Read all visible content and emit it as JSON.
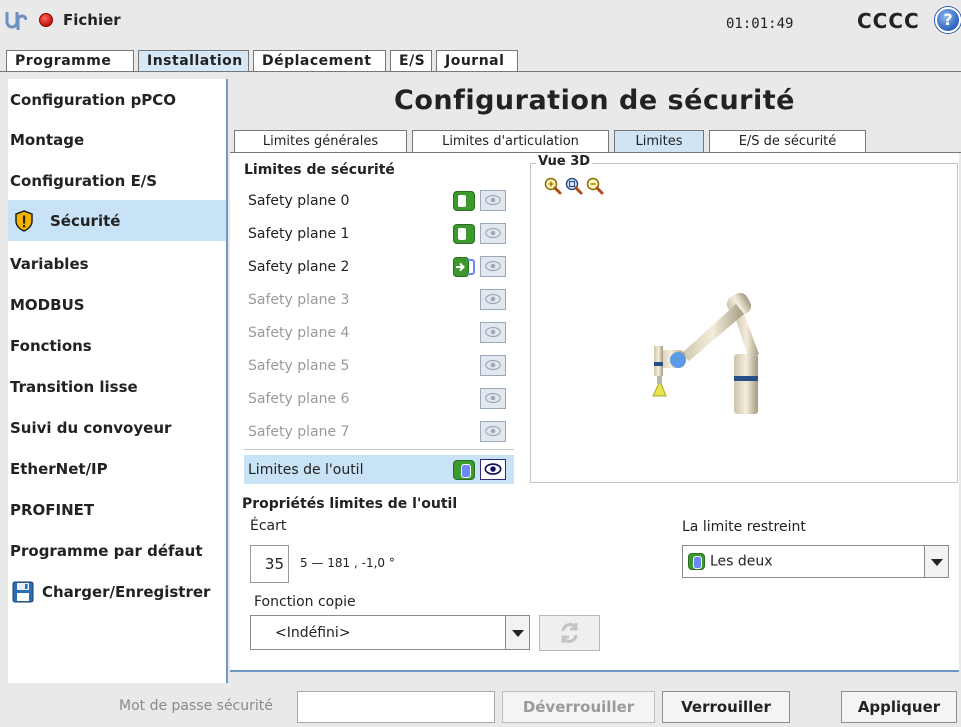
{
  "header": {
    "file_label": "Fichier",
    "clock": "01:01:49",
    "robot_name": "CCCC",
    "help_symbol": "?"
  },
  "main_tabs": [
    {
      "label": "Programme",
      "active": false
    },
    {
      "label": "Installation",
      "active": true
    },
    {
      "label": "Déplacement",
      "active": false
    },
    {
      "label": "E/S",
      "active": false
    },
    {
      "label": "Journal",
      "active": false
    }
  ],
  "sidebar": {
    "items": [
      {
        "label": "Configuration pPCO"
      },
      {
        "label": "Montage"
      },
      {
        "label": "Configuration E/S"
      },
      {
        "label": "Sécurité",
        "icon": "shield-warning-icon",
        "active": true
      },
      {
        "label": "Variables"
      },
      {
        "label": "MODBUS"
      },
      {
        "label": "Fonctions"
      },
      {
        "label": "Transition lisse"
      },
      {
        "label": "Suivi du convoyeur"
      },
      {
        "label": "EtherNet/IP"
      },
      {
        "label": "PROFINET"
      },
      {
        "label": "Programme par défaut"
      },
      {
        "label": "Charger/Enregistrer",
        "icon": "floppy-disk-icon"
      }
    ]
  },
  "page_title": "Configuration de sécurité",
  "sub_tabs": [
    {
      "label": "Limites générales",
      "active": false
    },
    {
      "label": "Limites d'articulation",
      "active": false
    },
    {
      "label": "Limites",
      "active": true
    },
    {
      "label": "E/S de sécurité",
      "active": false
    }
  ],
  "limits": {
    "section_title": "Limites de sécurité",
    "planes": [
      {
        "label": "Safety plane 0",
        "state": "on"
      },
      {
        "label": "Safety plane 1",
        "state": "on"
      },
      {
        "label": "Safety plane 2",
        "state": "trigger"
      },
      {
        "label": "Safety plane 3",
        "state": "disabled"
      },
      {
        "label": "Safety plane 4",
        "state": "disabled"
      },
      {
        "label": "Safety plane 5",
        "state": "disabled"
      },
      {
        "label": "Safety plane 6",
        "state": "disabled"
      },
      {
        "label": "Safety plane 7",
        "state": "disabled"
      }
    ],
    "tool_limit": {
      "label": "Limites de l'outil",
      "selected": true
    }
  },
  "view3d": {
    "title": "Vue 3D",
    "zoom_icons": [
      "zoom-in-icon",
      "zoom-reset-icon",
      "zoom-out-icon"
    ]
  },
  "tool_props": {
    "title": "Propriétés limites de l'outil",
    "ecart_label": "Écart",
    "ecart_value": "35",
    "ecart_range": "5 — 181 , -1,0 °",
    "restrict_label": "La limite restreint",
    "restrict_value": "Les deux",
    "copy_label": "Fonction copie",
    "copy_value": "<Indéfini>"
  },
  "footer": {
    "password_label": "Mot de passe sécurité",
    "password_value": "",
    "unlock_label": "Déverrouiller",
    "lock_label": "Verrouiller",
    "apply_label": "Appliquer"
  },
  "colors": {
    "active_tab": "#d6e8f6",
    "selection": "#c9e3f6",
    "toggle_green": "#3c9a2d",
    "tool_blue": "#6c8af7"
  }
}
